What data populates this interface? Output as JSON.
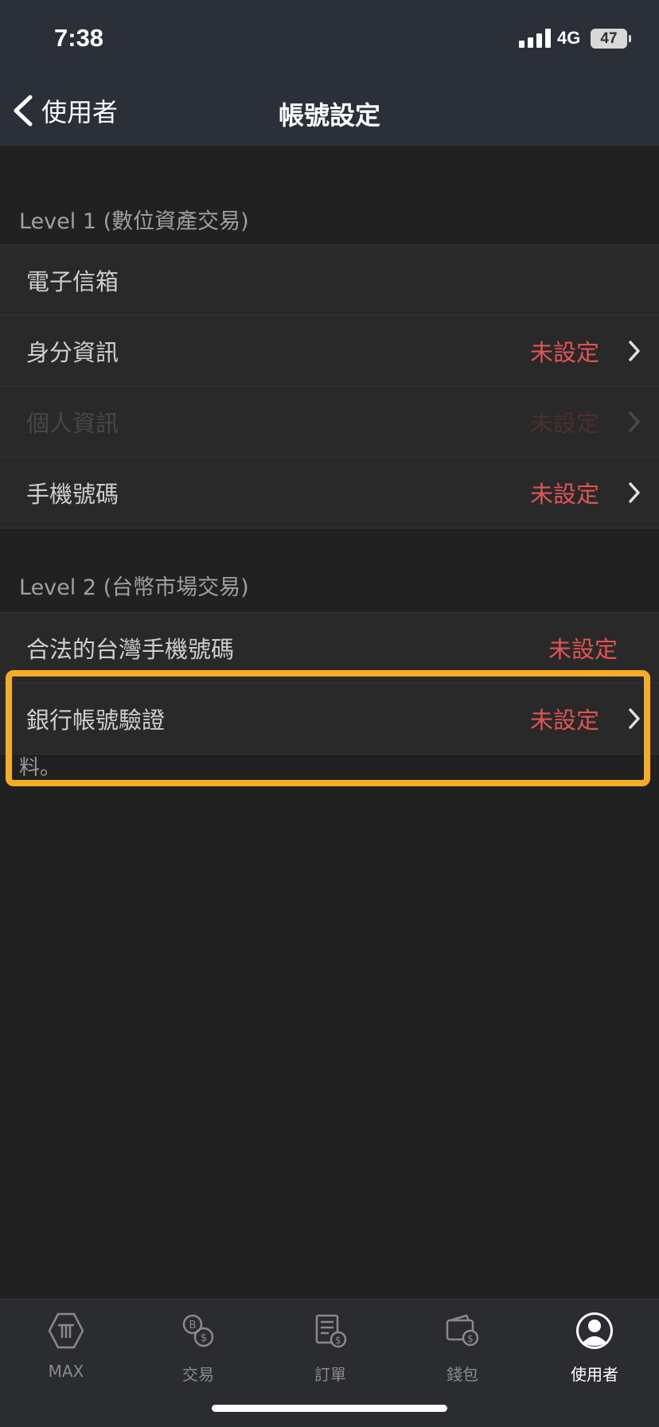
{
  "status_bar": {
    "time": "7:38",
    "network": "4G",
    "battery": "47"
  },
  "nav": {
    "back_label": "使用者",
    "title": "帳號設定"
  },
  "level1": {
    "header": "Level 1 (數位資產交易)",
    "rows": [
      {
        "label": "電子信箱",
        "status": ""
      },
      {
        "label": "身分資訊",
        "status": "未設定"
      },
      {
        "label": "個人資訊",
        "status": "未設定"
      },
      {
        "label": "手機號碼",
        "status": "未設定"
      }
    ]
  },
  "level2": {
    "header": "Level 2 (台幣市場交易)",
    "rows": [
      {
        "label": "合法的台灣手機號碼",
        "status": "未設定"
      },
      {
        "label": "銀行帳號驗證",
        "status": "未設定"
      }
    ],
    "note": "料。"
  },
  "tabs": [
    {
      "label": "MAX",
      "icon": "max-logo-icon"
    },
    {
      "label": "交易",
      "icon": "exchange-icon"
    },
    {
      "label": "訂單",
      "icon": "orders-icon"
    },
    {
      "label": "錢包",
      "icon": "wallet-icon"
    },
    {
      "label": "使用者",
      "icon": "user-icon"
    }
  ],
  "colors": {
    "highlight": "#f6ad26",
    "status_red": "#e05454",
    "bar": "#2b3038"
  }
}
